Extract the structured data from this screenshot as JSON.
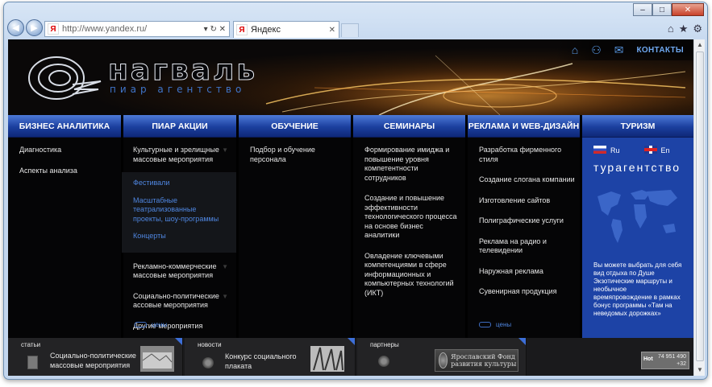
{
  "browser": {
    "url": "http://www.yandex.ru/",
    "address_controls": "▾ ↻ ✕",
    "tab_title": "Яндекс",
    "favicon": "Я",
    "window_buttons": [
      "–",
      "□",
      "✕"
    ],
    "tool_icons": [
      "home-icon",
      "star-icon",
      "gear-icon"
    ]
  },
  "header": {
    "logo_title": "нагваль",
    "logo_subtitle": "пиар агентство",
    "contacts_label": "КОНТАКТЫ",
    "icons": [
      "home-icon",
      "sitemap-icon",
      "mail-icon"
    ]
  },
  "menu": {
    "business": {
      "title": "БИЗНЕС АНАЛИТИКА",
      "items": [
        "Диагностика",
        "Аспекты анализа"
      ]
    },
    "pr": {
      "title": "ПИАР АКЦИИ",
      "item1": "Культурные и зрелищные массовые мероприятия",
      "subitems": [
        "Фестивали",
        "Масштабные театрализованные проекты, шоу-программы",
        "Концерты"
      ],
      "item2": "Рекламно-коммерческие массовые мероприятия",
      "item3": "Социально-политические ассовые мероприятия",
      "item4": "Другие мероприятия",
      "prices": "цены"
    },
    "training": {
      "title": "ОБУЧЕНИЕ",
      "items": [
        "Подбор и обучение персонала"
      ]
    },
    "seminars": {
      "title": "СЕМИНАРЫ",
      "items": [
        "Формирование имиджа и повышение уровня компетентности сотрудников",
        "Создание и повышение эффективности технологического процесса на основе бизнес аналитики",
        "Овладение ключевыми компетенциями в сфере информационных и компьютерных технологий (ИКТ)"
      ]
    },
    "ads": {
      "title": "РЕКЛАМА И WEB-ДИЗАЙН",
      "items": [
        "Разработка фирменного стиля",
        "Создание слогана компании",
        "Изготовление сайтов",
        "Полиграфические услуги",
        "Реклама на радио и телевидении",
        "Наружная реклама",
        "Сувенирная продукция"
      ],
      "prices": "цены"
    },
    "tourism": {
      "title": "ТУРИЗМ",
      "lang_ru": "Ru",
      "lang_en": "En",
      "agency": "турагентство",
      "text": "Вы можете выбрать для себя вид отдыха по Душе Экзотические маршруты и необычное времяпровождение в рамках бонус программы «Там на неведомых дорожках»"
    }
  },
  "footer": {
    "articles_label": "статьи",
    "articles_text": "Социально-политические массовые мероприятия",
    "news_label": "новости",
    "news_text": "Конкурс социального плаката",
    "partners_label": "партнеры",
    "fund_text": "Ярославский Фонд развития культуры",
    "counter_label": "Hot",
    "counter_top": "74 951 490",
    "counter_bottom": "+32"
  },
  "colors": {
    "menu_head": "#1b3f9e",
    "link_blue": "#4f86e0",
    "tourism_bg": "#1d43a6"
  }
}
